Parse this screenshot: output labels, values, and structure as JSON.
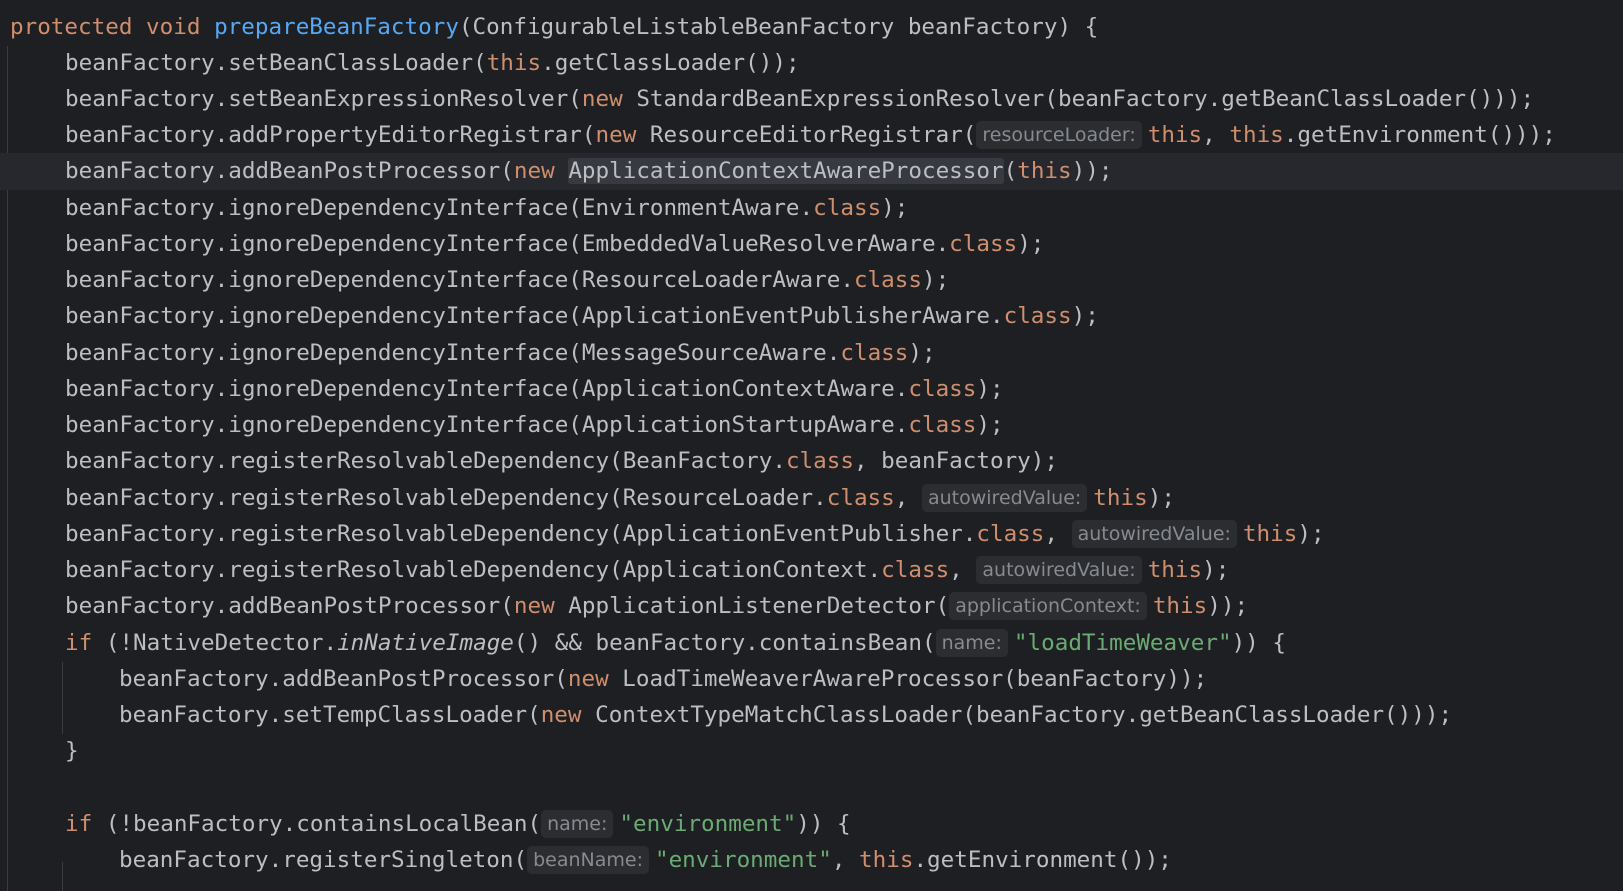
{
  "editor": {
    "signature": {
      "modifier": "protected",
      "return_type": "void",
      "method_name": "prepareBeanFactory",
      "params": "(ConfigurableListableBeanFactory beanFactory) {"
    },
    "lines": [
      {
        "a": "beanFactory.setBeanClassLoader(",
        "kw1": "this",
        "b": ".getClassLoader());"
      },
      {
        "a": "beanFactory.setBeanExpressionResolver(",
        "kw1": "new",
        "b": " StandardBeanExpressionResolver(beanFactory.getBeanClassLoader()));"
      },
      {
        "a": "beanFactory.addPropertyEditorRegistrar(",
        "kw1": "new",
        "b": " ResourceEditorRegistrar(",
        "hint": "resourceLoader:",
        "kw2": "this",
        "c": ", ",
        "kw3": "this",
        "d": ".getEnvironment()));"
      },
      {
        "a": "beanFactory.addBeanPostProcessor(",
        "kw1": "new",
        "b": " ",
        "hl": "ApplicationContextAwareProcessor",
        "c": "(",
        "kw2": "this",
        "d": "));"
      },
      {
        "a": "beanFactory.ignoreDependencyInterface(EnvironmentAware.",
        "kw1": "class",
        "b": ");"
      },
      {
        "a": "beanFactory.ignoreDependencyInterface(EmbeddedValueResolverAware.",
        "kw1": "class",
        "b": ");"
      },
      {
        "a": "beanFactory.ignoreDependencyInterface(ResourceLoaderAware.",
        "kw1": "class",
        "b": ");"
      },
      {
        "a": "beanFactory.ignoreDependencyInterface(ApplicationEventPublisherAware.",
        "kw1": "class",
        "b": ");"
      },
      {
        "a": "beanFactory.ignoreDependencyInterface(MessageSourceAware.",
        "kw1": "class",
        "b": ");"
      },
      {
        "a": "beanFactory.ignoreDependencyInterface(ApplicationContextAware.",
        "kw1": "class",
        "b": ");"
      },
      {
        "a": "beanFactory.ignoreDependencyInterface(ApplicationStartupAware.",
        "kw1": "class",
        "b": ");"
      },
      {
        "a": "beanFactory.registerResolvableDependency(BeanFactory.",
        "kw1": "class",
        "b": ", beanFactory);"
      },
      {
        "a": "beanFactory.registerResolvableDependency(ResourceLoader.",
        "kw1": "class",
        "b": ", ",
        "hint": "autowiredValue:",
        "kw2": "this",
        "c": ");"
      },
      {
        "a": "beanFactory.registerResolvableDependency(ApplicationEventPublisher.",
        "kw1": "class",
        "b": ", ",
        "hint": "autowiredValue:",
        "kw2": "this",
        "c": ");"
      },
      {
        "a": "beanFactory.registerResolvableDependency(ApplicationContext.",
        "kw1": "class",
        "b": ", ",
        "hint": "autowiredValue:",
        "kw2": "this",
        "c": ");"
      },
      {
        "a": "beanFactory.addBeanPostProcessor(",
        "kw1": "new",
        "b": " ApplicationListenerDetector(",
        "hint": "applicationContext:",
        "kw2": "this",
        "c": "));"
      },
      {
        "kw1": "if",
        "a": " (!NativeDetector.",
        "it": "inNativeImage",
        "b": "() && beanFactory.containsBean(",
        "hint": "name:",
        "str": "\"loadTimeWeaver\"",
        "c": ")) {"
      },
      {
        "a": "beanFactory.addBeanPostProcessor(",
        "kw1": "new",
        "b": " LoadTimeWeaverAwareProcessor(beanFactory));"
      },
      {
        "a": "beanFactory.setTempClassLoader(",
        "kw1": "new",
        "b": " ContextTypeMatchClassLoader(beanFactory.getBeanClassLoader()));"
      },
      {
        "a": "}"
      },
      {
        "kw1": "if",
        "a": " (!beanFactory.containsLocalBean(",
        "hint": "name:",
        "str": "\"environment\"",
        "b": ")) {"
      },
      {
        "a": "beanFactory.registerSingleton(",
        "hint": "beanName:",
        "str": "\"environment\"",
        "b": ", ",
        "kw1": "this",
        "c": ".getEnvironment());"
      }
    ]
  },
  "colors": {
    "background": "#1e1f22",
    "current_line": "#26282e",
    "text": "#bcbec4",
    "keyword": "#cf8e6d",
    "method_declaration": "#56a8f5",
    "string": "#6aab73",
    "hint_text": "#868a91",
    "hint_background": "#2b2d30"
  }
}
